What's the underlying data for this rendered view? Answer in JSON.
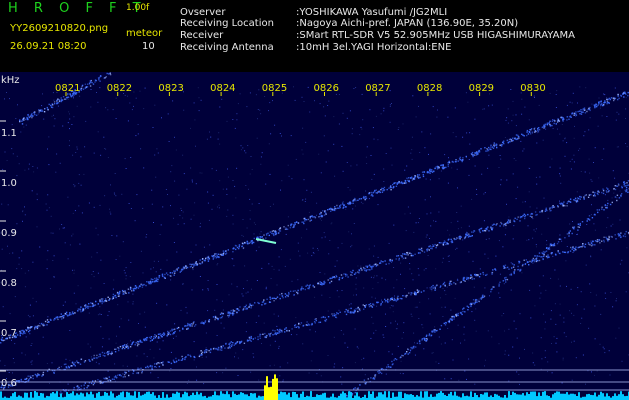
{
  "header": {
    "app_title": "H R O F F T",
    "version": "1.00f",
    "filename": "YY2609210820.png",
    "datetime": "26.09.21 08:20",
    "type_label": "meteor",
    "count": "10",
    "info": [
      {
        "label": "Ovserver",
        "value": ":YOSHIKAWA Yasufumi /JG2MLI"
      },
      {
        "label": "Receiving Location",
        "value": ":Nagoya Aichi-pref. JAPAN (136.90E, 35.20N)"
      },
      {
        "label": "Receiver",
        "value": ":SMart RTL-SDR V5 52.905MHz USB HIGASHIMURAYAMA"
      },
      {
        "label": "Receiving Antenna",
        "value": ":10mH 3el.YAGI Horizontal:ENE"
      }
    ]
  },
  "spectrogram": {
    "unit_label": "kHz",
    "y_ticks": [
      "1.1",
      "1.0",
      "0.9",
      "0.8",
      "0.7",
      "0.6"
    ],
    "y_tick_values": [
      1.1,
      1.0,
      0.9,
      0.8,
      0.7,
      0.6
    ],
    "time_ticks": [
      "0821",
      "0822",
      "0823",
      "0824",
      "0825",
      "0826",
      "0827",
      "0828",
      "0829",
      "0830"
    ],
    "colors": {
      "background": "#00003a",
      "trace": "#3c6cff",
      "axis_text": "#e8e8e8",
      "time_text": "#e6e600",
      "signal_bar": "#00c8ff",
      "signal_peak": "#ffff00"
    }
  }
}
